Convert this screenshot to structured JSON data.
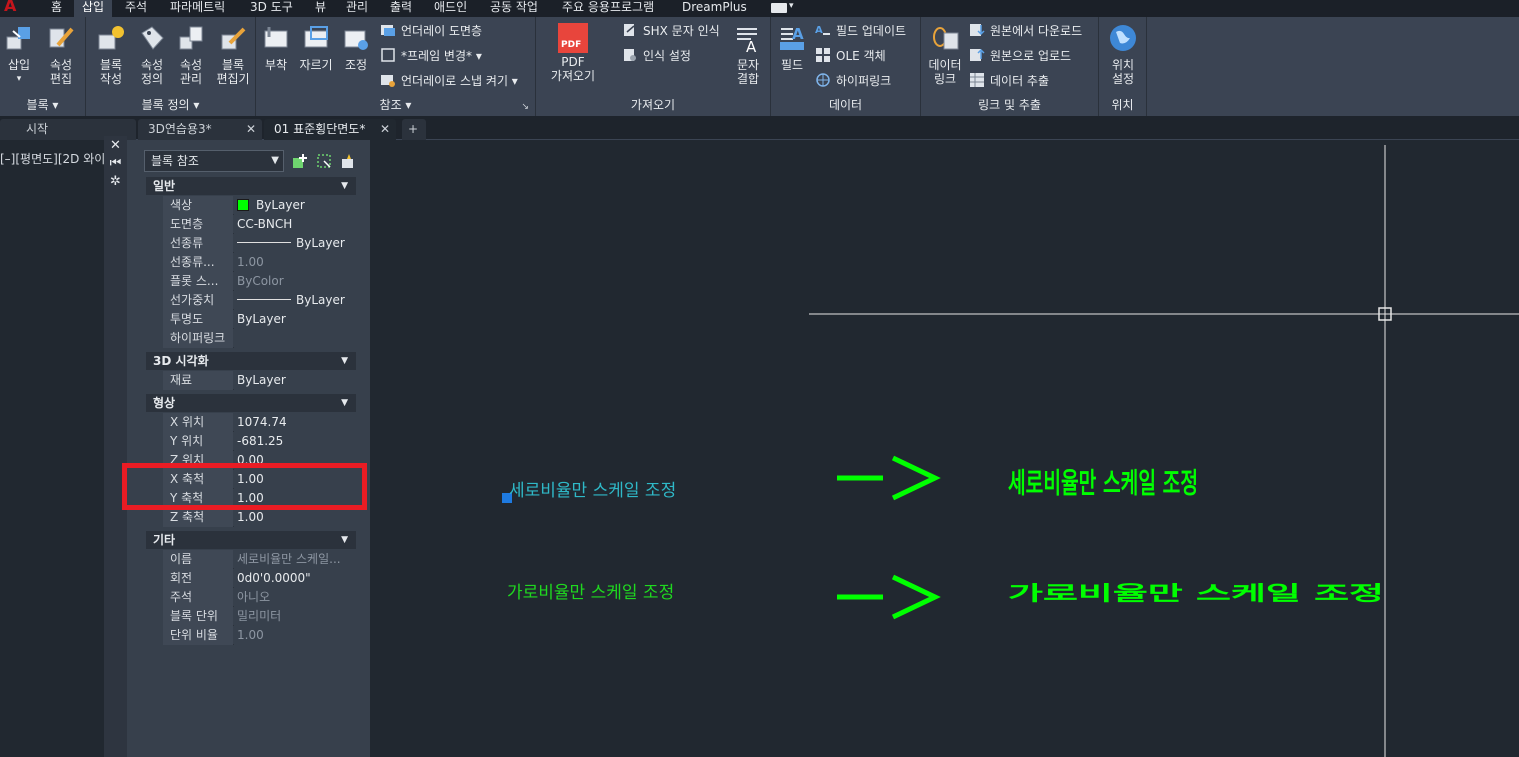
{
  "app": {
    "logo": "A"
  },
  "menu_tabs": [
    "홈",
    "삽입",
    "주석",
    "파라메트릭",
    "3D 도구",
    "뷰",
    "관리",
    "출력",
    "애드인",
    "공동 작업",
    "주요 응용프로그램",
    "DreamPlus"
  ],
  "active_menu_tab": "삽입",
  "ribbon": {
    "block": {
      "title": "블록 ▾",
      "insert": "삽입",
      "attr_edit": "속성\n편집"
    },
    "block_def": {
      "title": "블록 정의 ▾",
      "create": "블록\n작성",
      "define_attr": "속성\n정의",
      "manage_attr": "속성\n관리",
      "block_editor": "블록\n편집기"
    },
    "reference": {
      "title": "참조 ▾",
      "attach": "부착",
      "clip": "자르기",
      "adjust": "조정",
      "underlay_layers": "언더레이 도면층",
      "frames": "*프레임 변경* ▾",
      "snap": "언더레이로 스냅 켜기 ▾"
    },
    "import": {
      "title": "가져오기",
      "pdf_import": "PDF\n가져오기",
      "shx": "SHX 문자 인식",
      "recog_settings": "인식 설정",
      "combine_text": "문자\n결합",
      "pdf_icon_text": "PDF"
    },
    "data": {
      "title": "데이터",
      "field": "필드",
      "update_fields": "필드 업데이트",
      "ole": "OLE 객체",
      "hyperlink": "하이퍼링크"
    },
    "link": {
      "title": "링크 및 추출",
      "data_link": "데이터\n링크",
      "download": "원본에서 다운로드",
      "upload": "원본으로 업로드",
      "extract": "데이터  추출"
    },
    "location": {
      "title": "위치",
      "set_location": "위치\n설정"
    }
  },
  "doc_tabs": [
    {
      "label": "시작",
      "close": ""
    },
    {
      "label": "3D연습용3*",
      "close": "✕"
    },
    {
      "label": "01 표준횡단면도*",
      "close": "✕"
    }
  ],
  "new_tab": "+",
  "viewport_label": "[–][평면도][2D 와이",
  "palette": {
    "strip": [
      "✕",
      "⏮",
      "✲"
    ],
    "selector": "블록 참조",
    "sections": {
      "general": "일반",
      "viz3d": "3D 시각화",
      "geometry": "형상",
      "misc": "기타"
    },
    "general_rows": [
      {
        "k": "색상",
        "v": "ByLayer"
      },
      {
        "k": "도면층",
        "v": "CC-BNCH"
      },
      {
        "k": "선종류",
        "v": "ByLayer"
      },
      {
        "k": "선종류...",
        "v": "1.00"
      },
      {
        "k": "플롯 스...",
        "v": "ByColor"
      },
      {
        "k": "선가중치",
        "v": "ByLayer"
      },
      {
        "k": "투명도",
        "v": "ByLayer"
      },
      {
        "k": "하이퍼링크",
        "v": ""
      }
    ],
    "viz_rows": [
      {
        "k": "재료",
        "v": "ByLayer"
      }
    ],
    "geometry_rows": [
      {
        "k": "X 위치",
        "v": "1074.74"
      },
      {
        "k": "Y 위치",
        "v": "-681.25"
      },
      {
        "k": "Z 위치",
        "v": "0.00"
      },
      {
        "k": "X 축척",
        "v": "1.00"
      },
      {
        "k": "Y 축척",
        "v": "1.00"
      },
      {
        "k": "Z 축척",
        "v": "1.00"
      }
    ],
    "misc_rows": [
      {
        "k": "이름",
        "v": "세로비율만 스케일..."
      },
      {
        "k": "회전",
        "v": "0d0'0.0000\""
      },
      {
        "k": "주석",
        "v": "아니오"
      },
      {
        "k": "블록 단위",
        "v": "밀리미터"
      },
      {
        "k": "단위 비율",
        "v": "1.00"
      }
    ]
  },
  "drawing": {
    "text_vertical": "세로비율만 스케일 조정",
    "text_horizontal": "가로비율만 스케일 조정",
    "result_vertical": "세로비율만 스케일 조정",
    "result_horizontal": "가로비율만 스케일 조정",
    "colors": {
      "cyan": "#2fb9c8",
      "green": "#00ff00",
      "line": "#e6e6e6"
    }
  }
}
